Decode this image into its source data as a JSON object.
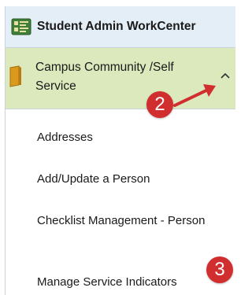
{
  "header": {
    "title": "Student Admin WorkCenter",
    "icon": "workcenter-icon"
  },
  "section": {
    "label": "Campus Community /Self Service",
    "icon": "folder-icon",
    "expanded": true,
    "toggle_icon": "chevron-up-icon"
  },
  "menu": {
    "items": [
      {
        "label": "Addresses"
      },
      {
        "label": "Add/Update a Person"
      },
      {
        "label": "Checklist Management - Person"
      },
      {
        "label": "Manage Service Indicators"
      }
    ]
  },
  "annotations": {
    "step2": "2",
    "step3": "3",
    "color": "#d12f2f"
  }
}
